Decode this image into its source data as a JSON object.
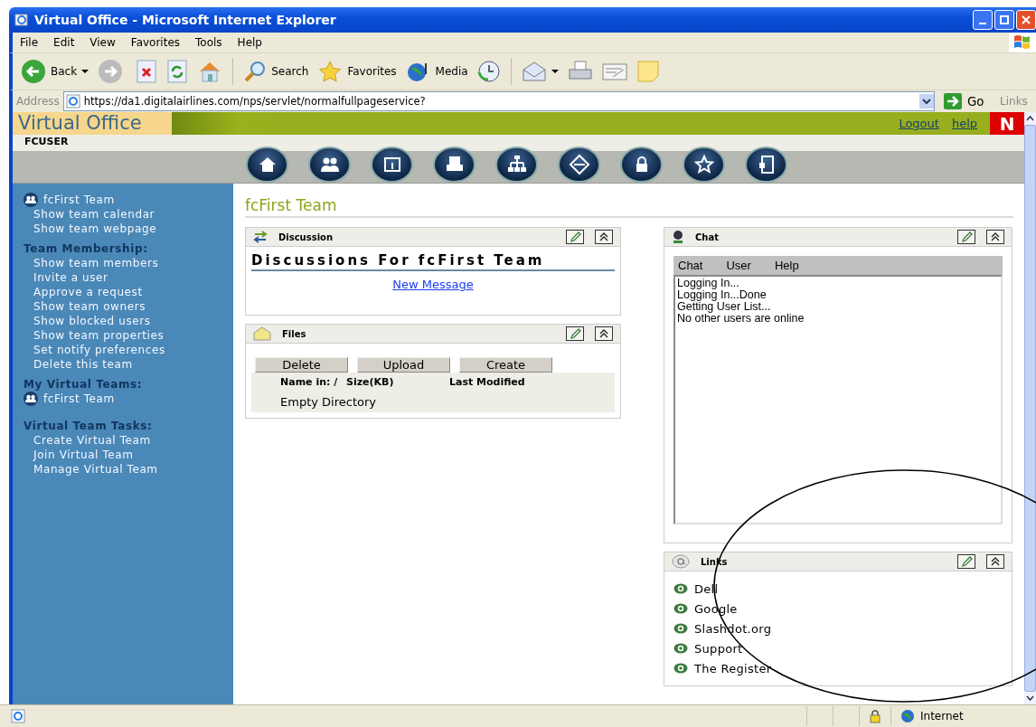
{
  "window": {
    "title": "Virtual Office - Microsoft Internet Explorer"
  },
  "menu": [
    {
      "label": "File"
    },
    {
      "label": "Edit"
    },
    {
      "label": "View"
    },
    {
      "label": "Favorites"
    },
    {
      "label": "Tools"
    },
    {
      "label": "Help"
    }
  ],
  "toolbar": [
    {
      "kind": "back",
      "label": "Back"
    },
    {
      "kind": "forward"
    },
    {
      "kind": "stop"
    },
    {
      "kind": "refresh"
    },
    {
      "kind": "home"
    },
    {
      "kind": "search",
      "label": "Search"
    },
    {
      "kind": "favorites",
      "label": "Favorites"
    },
    {
      "kind": "media",
      "label": "Media"
    },
    {
      "kind": "history"
    },
    {
      "kind": "mail"
    },
    {
      "kind": "print"
    },
    {
      "kind": "edit"
    },
    {
      "kind": "note"
    }
  ],
  "address": {
    "label": "Address",
    "value": "https://da1.digitalairlines.com/nps/servlet/normalfullpageservice?",
    "go": "Go",
    "links": "Links"
  },
  "site": {
    "brand": "Virtual Office",
    "user": "FCUSER",
    "header_links": [
      "Logout",
      "help"
    ],
    "logo": "N"
  },
  "sidebar": [
    {
      "kind": "team",
      "label": "fcFirst Team"
    },
    {
      "kind": "link",
      "label": "Show team calendar"
    },
    {
      "kind": "link",
      "label": "Show team webpage"
    },
    {
      "kind": "heading",
      "label": "Team Membership:"
    },
    {
      "kind": "link",
      "label": "Show team members"
    },
    {
      "kind": "link",
      "label": "Invite a user"
    },
    {
      "kind": "link",
      "label": "Approve a request"
    },
    {
      "kind": "link",
      "label": "Show team owners"
    },
    {
      "kind": "link",
      "label": "Show blocked users"
    },
    {
      "kind": "link",
      "label": "Show team properties"
    },
    {
      "kind": "link",
      "label": "Set notify preferences"
    },
    {
      "kind": "link",
      "label": "Delete this team"
    },
    {
      "kind": "heading",
      "label": "My Virtual Teams:"
    },
    {
      "kind": "team",
      "label": "fcFirst Team"
    },
    {
      "kind": "heading",
      "label": "Virtual Team Tasks:"
    },
    {
      "kind": "link",
      "label": "Create Virtual Team"
    },
    {
      "kind": "link",
      "label": "Join Virtual Team"
    },
    {
      "kind": "link",
      "label": "Manage Virtual Team"
    }
  ],
  "page_title": "fcFirst Team",
  "discussion": {
    "title": "Discussion",
    "heading": "Discussions For fcFirst Team",
    "link": "New Message"
  },
  "files": {
    "title": "Files",
    "buttons": [
      "Delete",
      "Upload",
      "Create"
    ],
    "columns": [
      "Name in: /",
      "Size(KB)",
      "Last Modified"
    ],
    "empty": "Empty Directory"
  },
  "chat": {
    "title": "Chat",
    "menu": [
      "Chat",
      "User",
      "Help"
    ],
    "log": [
      "Logging In...",
      "Logging In...Done",
      "Getting User List...",
      "No other users are online"
    ]
  },
  "links": {
    "title": "Links",
    "items": [
      "Dell",
      "Google",
      "Slashdot.org",
      "Support",
      "The Register"
    ]
  },
  "status_bar": {
    "zone": "Internet"
  }
}
